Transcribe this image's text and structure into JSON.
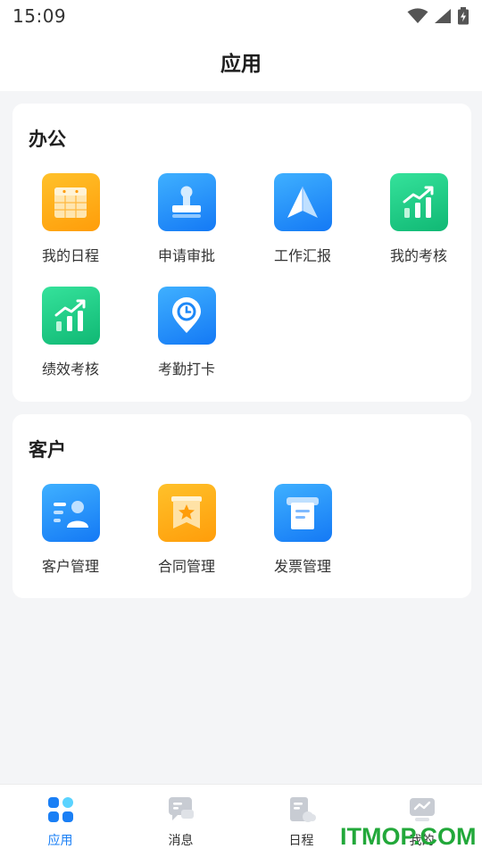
{
  "status_bar": {
    "time": "15:09",
    "icons": [
      "wifi-icon",
      "signal-icon",
      "battery-charging-icon"
    ]
  },
  "header": {
    "title": "应用"
  },
  "sections": [
    {
      "title": "办公",
      "apps": [
        {
          "label": "我的日程",
          "icon": "calendar-icon",
          "color": "orange"
        },
        {
          "label": "申请审批",
          "icon": "stamp-icon",
          "color": "blue"
        },
        {
          "label": "工作汇报",
          "icon": "paper-plane-icon",
          "color": "blue"
        },
        {
          "label": "我的考核",
          "icon": "growth-chart-icon",
          "color": "green"
        },
        {
          "label": "绩效考核",
          "icon": "growth-chart-icon",
          "color": "green"
        },
        {
          "label": "考勤打卡",
          "icon": "clock-pin-icon",
          "color": "blue"
        }
      ]
    },
    {
      "title": "客户",
      "apps": [
        {
          "label": "客户管理",
          "icon": "customer-card-icon",
          "color": "blue"
        },
        {
          "label": "合同管理",
          "icon": "contract-star-icon",
          "color": "orange"
        },
        {
          "label": "发票管理",
          "icon": "invoice-icon",
          "color": "blue"
        }
      ]
    }
  ],
  "tabbar": {
    "items": [
      {
        "label": "应用",
        "icon": "apps-grid-icon",
        "active": true
      },
      {
        "label": "消息",
        "icon": "message-icon",
        "active": false
      },
      {
        "label": "日程",
        "icon": "schedule-icon",
        "active": false
      },
      {
        "label": "我的",
        "icon": "profile-icon",
        "active": false
      }
    ]
  },
  "watermark": "ITMOP.COM",
  "colors": {
    "accent": "#1a7ff5",
    "orange": "#ffa312",
    "blue": "#1e88f7",
    "green": "#17c47f",
    "watermark": "#22a83a"
  }
}
